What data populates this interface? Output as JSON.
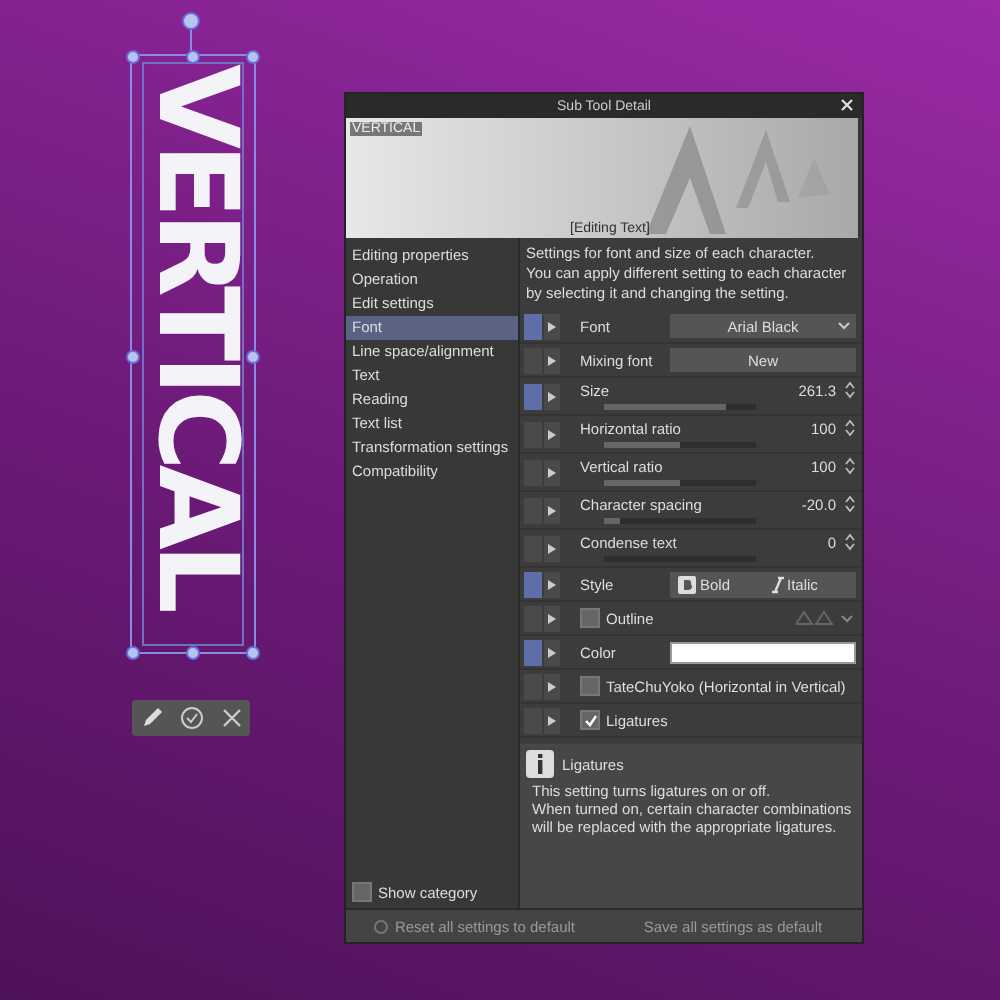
{
  "canvas": {
    "text": "VERTICAL"
  },
  "window": {
    "title": "Sub Tool Detail",
    "preview": {
      "label": "VERTICAL",
      "caption": "[Editing Text]"
    }
  },
  "categories": [
    {
      "label": "Editing properties",
      "selected": false
    },
    {
      "label": "Operation",
      "selected": false
    },
    {
      "label": "Edit settings",
      "selected": false
    },
    {
      "label": "Font",
      "selected": true
    },
    {
      "label": "Line space/alignment",
      "selected": false
    },
    {
      "label": "Text",
      "selected": false
    },
    {
      "label": "Reading",
      "selected": false
    },
    {
      "label": "Text list",
      "selected": false
    },
    {
      "label": "Transformation settings",
      "selected": false
    },
    {
      "label": "Compatibility",
      "selected": false
    }
  ],
  "show_category": {
    "label": "Show category",
    "checked": false
  },
  "description": "Settings for font and size of each character.\nYou can apply different setting to each character by selecting it and changing the setting.",
  "settings": [
    {
      "kind": "select",
      "label": "Font",
      "value": "Arial Black",
      "pinned": true
    },
    {
      "kind": "button",
      "label": "Mixing font",
      "value": "New",
      "pinned": false
    },
    {
      "kind": "slider",
      "label": "Size",
      "value": "261.3",
      "level": 0.8,
      "pinned": true
    },
    {
      "kind": "slider",
      "label": "Horizontal ratio",
      "value": "100",
      "level": 0.5,
      "pinned": false
    },
    {
      "kind": "slider",
      "label": "Vertical ratio",
      "value": "100",
      "level": 0.5,
      "pinned": false
    },
    {
      "kind": "slider",
      "label": "Character spacing",
      "value": "-20.0",
      "level": 0.1,
      "pinned": false
    },
    {
      "kind": "slider",
      "label": "Condense text",
      "value": "0",
      "level": 0,
      "pinned": false
    },
    {
      "kind": "style",
      "label": "Style",
      "options": [
        "Bold",
        "Italic"
      ],
      "pinned": true
    },
    {
      "kind": "outline",
      "label": "Outline",
      "checked": false,
      "pinned": false
    },
    {
      "kind": "color",
      "label": "Color",
      "color": "#ffffff",
      "pinned": true
    },
    {
      "kind": "checkbox",
      "label": "TateChuYoko (Horizontal in Vertical)",
      "checked": false,
      "pinned": false
    },
    {
      "kind": "checkbox",
      "label": "Ligatures",
      "checked": true,
      "pinned": false
    }
  ],
  "info": {
    "title": "Ligatures",
    "text": "This setting turns ligatures on or off.\nWhen turned on, certain character combinations will be replaced with the appropriate ligatures."
  },
  "footer": [
    "Reset all settings to default",
    "Save all settings as default"
  ]
}
